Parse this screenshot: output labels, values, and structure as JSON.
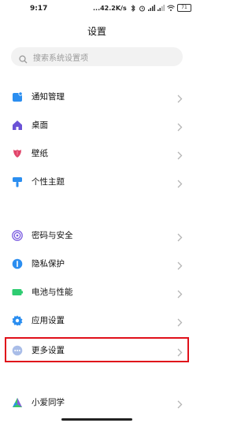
{
  "status_bar": {
    "time": "9:17",
    "net_speed": "...42.2K/s",
    "battery": "71"
  },
  "header": {
    "title": "设置"
  },
  "search": {
    "placeholder": "搜索系统设置项"
  },
  "items": [
    {
      "label": "通知管理",
      "icon": "notification-icon",
      "color": "#2b8ef0"
    },
    {
      "label": "桌面",
      "icon": "home-icon",
      "color": "#6b52d6"
    },
    {
      "label": "壁纸",
      "icon": "tulip-icon",
      "color": "#e0456a"
    },
    {
      "label": "个性主题",
      "icon": "brush-icon",
      "color": "#2b8ef0"
    },
    {
      "label": "密码与安全",
      "icon": "fingerprint-icon",
      "color": "#7a5be0"
    },
    {
      "label": "隐私保护",
      "icon": "privacy-icon",
      "color": "#2b8ef0"
    },
    {
      "label": "电池与性能",
      "icon": "battery-icon",
      "color": "#2ecc71"
    },
    {
      "label": "应用设置",
      "icon": "gear-icon",
      "color": "#2b8ef0"
    },
    {
      "label": "更多设置",
      "icon": "more-icon",
      "color": "#8aa4e0"
    },
    {
      "label": "小爱同学",
      "icon": "xiaoai-icon",
      "color": "#3bc46a"
    }
  ],
  "highlight_color": "#e0101a"
}
